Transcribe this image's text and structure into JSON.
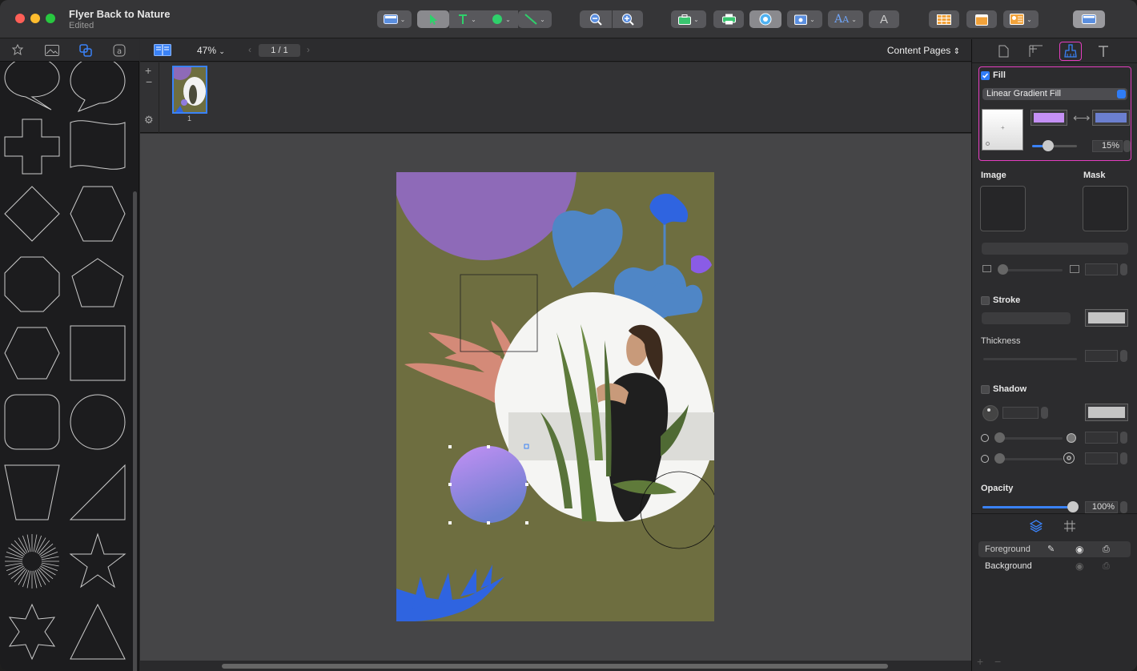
{
  "window": {
    "title": "Flyer Back to Nature",
    "status": "Edited"
  },
  "doc_toolbar": {
    "zoom": "47%",
    "page_field": "1 / 1",
    "page_set": "Content Pages"
  },
  "thumbnails": [
    {
      "number": "1"
    }
  ],
  "inspector": {
    "fill": {
      "label": "Fill",
      "checked": true,
      "type": "Linear Gradient Fill",
      "start_color": "#c490f5",
      "end_color": "#6b7fcf",
      "percent": "15%",
      "percent_value": 0.15
    },
    "image_label": "Image",
    "mask_label": "Mask",
    "stroke_label": "Stroke",
    "thickness_label": "Thickness",
    "shadow_label": "Shadow",
    "opacity": {
      "label": "Opacity",
      "value": "100%",
      "value_fraction": 1.0
    }
  },
  "layers": [
    {
      "name": "Foreground",
      "selected": true
    },
    {
      "name": "Background",
      "selected": false
    }
  ],
  "colors": {
    "accent": "#2f7cf6",
    "highlight": "#e43ec0",
    "page_bg": "#6e6e40",
    "purple_blob": "#8e6ab8",
    "blue_leaf": "#4f86c6",
    "salmon_leaf": "#d48a78",
    "bright_blue": "#2f64e0"
  }
}
